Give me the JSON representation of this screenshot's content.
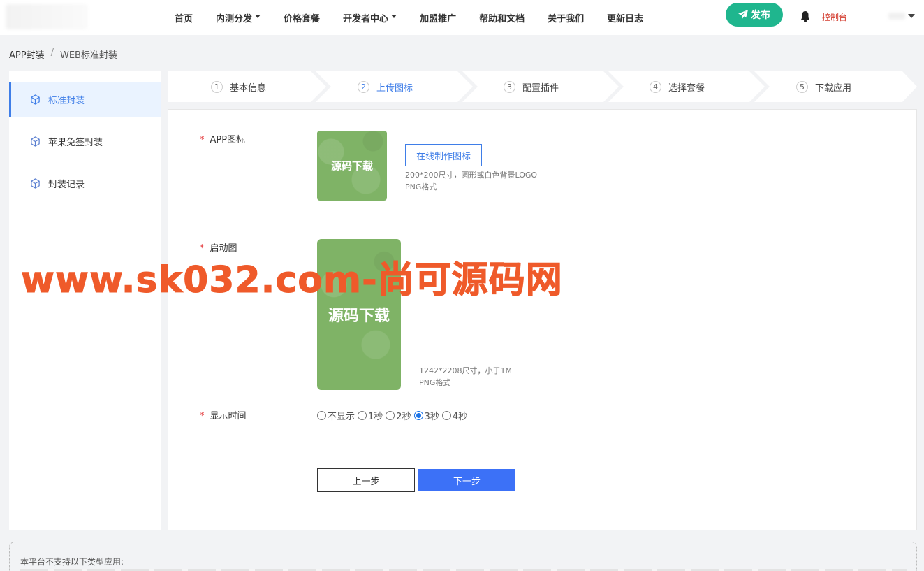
{
  "header": {
    "nav": [
      {
        "label": "首页",
        "has_caret": false
      },
      {
        "label": "内测分发",
        "has_caret": true
      },
      {
        "label": "价格套餐",
        "has_caret": false
      },
      {
        "label": "开发者中心",
        "has_caret": true
      },
      {
        "label": "加盟推广",
        "has_caret": false
      },
      {
        "label": "帮助和文档",
        "has_caret": false
      },
      {
        "label": "关于我们",
        "has_caret": false
      },
      {
        "label": "更新日志",
        "has_caret": false
      }
    ],
    "publish_label": "发布",
    "console_label": "控制台",
    "icons": {
      "publish": "send-icon",
      "bell": "bell-icon"
    },
    "colors": {
      "publish": "#1fb68e",
      "console": "#d33a2c"
    }
  },
  "breadcrumb": {
    "root": "APP封装",
    "sep": "/",
    "current": "WEB标准封装"
  },
  "sidebar": {
    "items": [
      {
        "label": "标准封装",
        "active": true,
        "icon": "cube-icon"
      },
      {
        "label": "苹果免签封装",
        "active": false,
        "icon": "cube-icon"
      },
      {
        "label": "封装记录",
        "active": false,
        "icon": "cube-icon"
      }
    ]
  },
  "steps": [
    {
      "num": "1",
      "label": "基本信息",
      "active": false
    },
    {
      "num": "2",
      "label": "上传图标",
      "active": true
    },
    {
      "num": "3",
      "label": "配置插件",
      "active": false
    },
    {
      "num": "4",
      "label": "选择套餐",
      "active": false
    },
    {
      "num": "5",
      "label": "下载应用",
      "active": false
    }
  ],
  "form": {
    "required_mark": "*",
    "icon": {
      "label": "APP图标",
      "image_text": "源码下载",
      "make_button": "在线制作图标",
      "hint_line1": "200*200尺寸，圆形或白色背景LOGO",
      "hint_line2": "PNG格式"
    },
    "splash": {
      "label": "启动图",
      "image_text": "源码下载",
      "hint_line1": "1242*2208尺寸，小于1M",
      "hint_line2": "PNG格式"
    },
    "display_time": {
      "label": "显示时间",
      "options": [
        "不显示",
        "1秒",
        "2秒",
        "3秒",
        "4秒"
      ],
      "selected": "3秒"
    },
    "prev_button": "上一步",
    "next_button": "下一步",
    "colors": {
      "accent": "#3f7ee8",
      "next_button": "#3c71f7",
      "image_bg": "#7fb366"
    }
  },
  "notice": {
    "title": "本平台不支持以下类型应用:"
  },
  "watermark": "www.sk032.com-尚可源码网"
}
